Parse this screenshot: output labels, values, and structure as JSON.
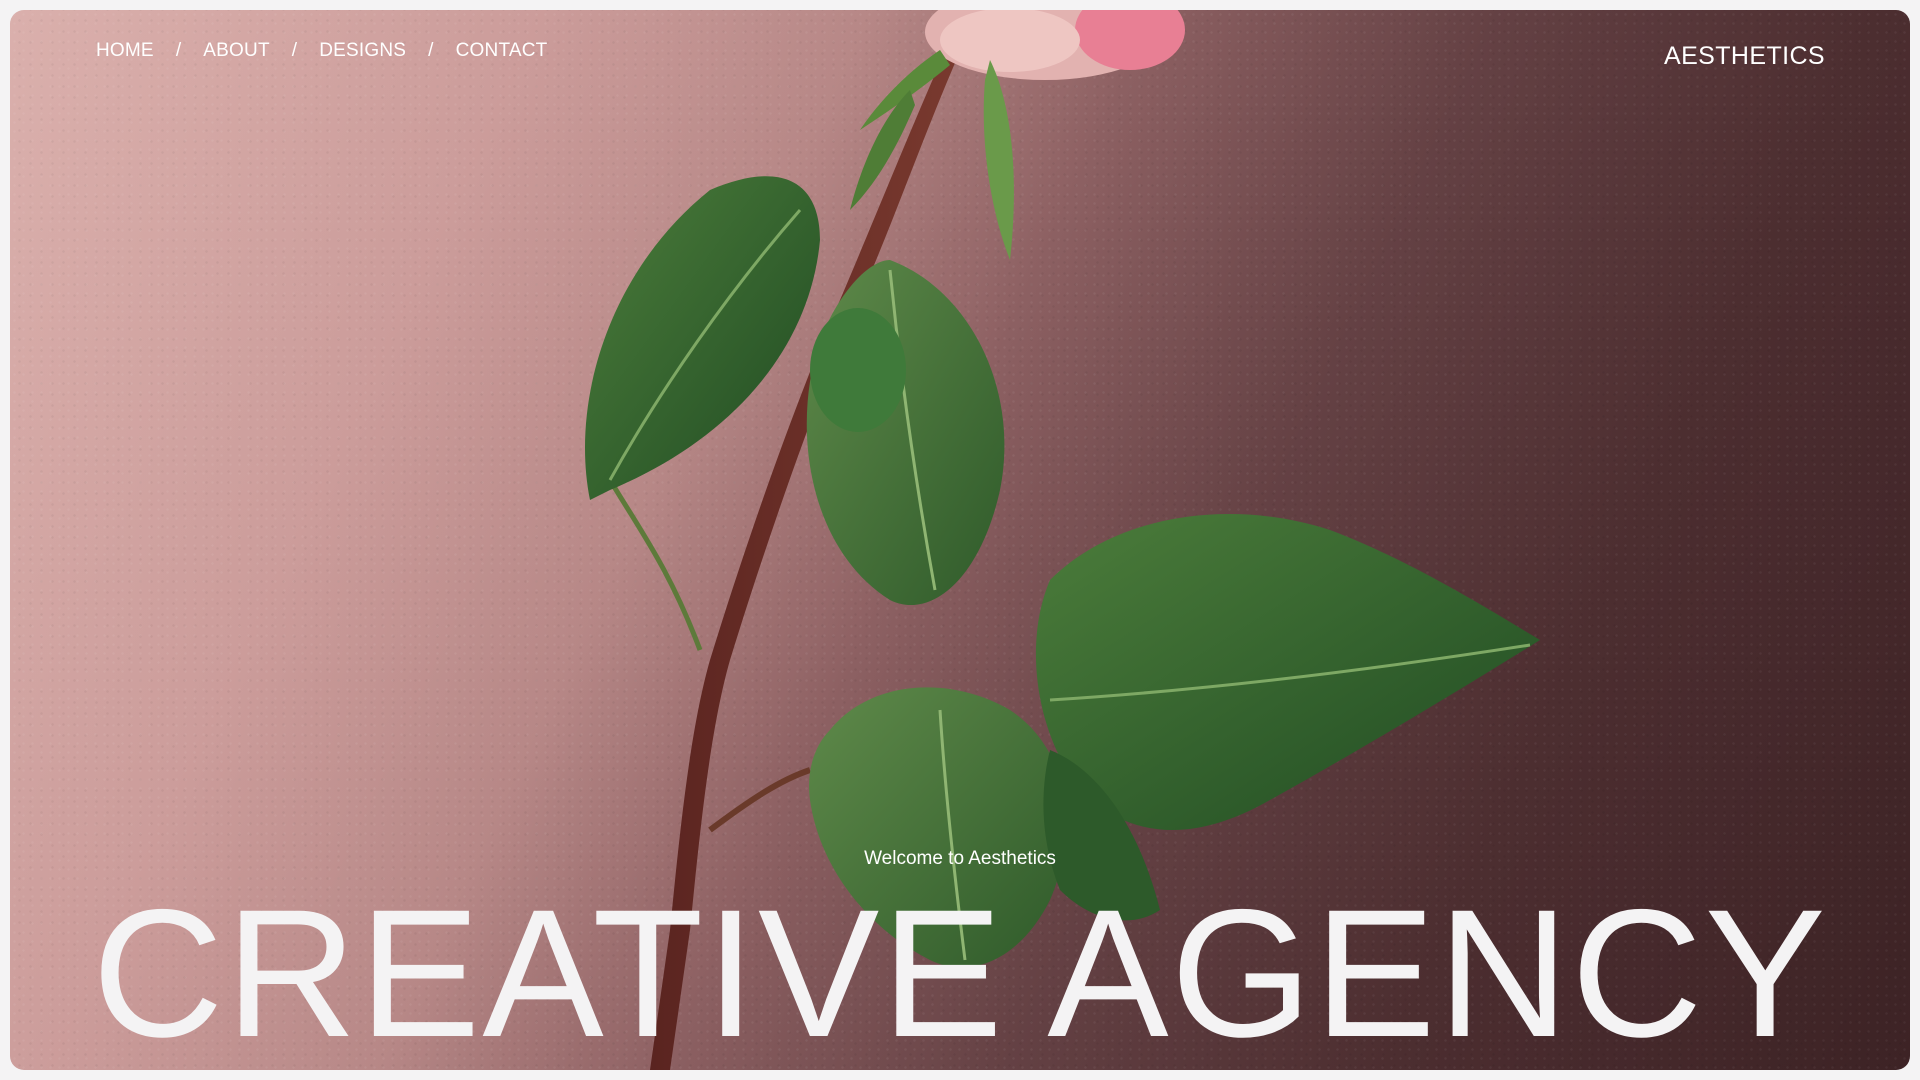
{
  "nav": {
    "items": [
      {
        "label": "HOME"
      },
      {
        "label": "ABOUT"
      },
      {
        "label": "DESIGNS"
      },
      {
        "label": "CONTACT"
      }
    ],
    "separator": "/"
  },
  "brand": {
    "label": "AESTHETICS"
  },
  "hero": {
    "welcome": "Welcome to Aesthetics",
    "headline": "CREATIVE AGENCY"
  },
  "colors": {
    "background_light": "#d6a9a5",
    "background_dark": "#4a2a2d",
    "text": "#ffffff",
    "headline": "#f4f3f4",
    "leaf": "#3f6a32",
    "stem": "#6a2a22",
    "rose": "#e8aeb0"
  }
}
